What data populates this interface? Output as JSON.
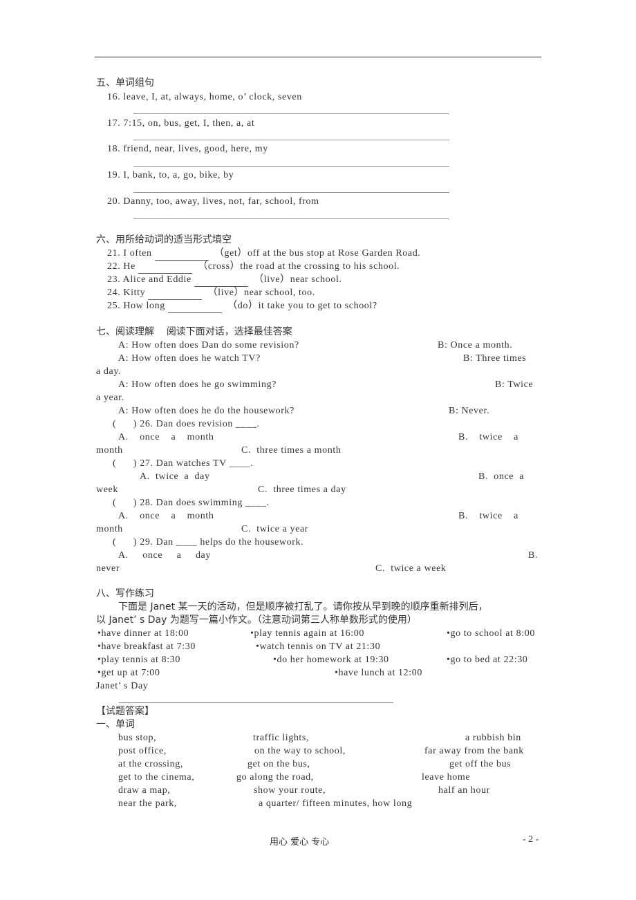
{
  "section5": {
    "title": "五、单词组句",
    "items": [
      {
        "num": "16.",
        "text": "leave, I, at, always, home, o’ clock, seven"
      },
      {
        "num": "17.",
        "text": "7:15, on, bus, get, I, then, a, at"
      },
      {
        "num": "18.",
        "text": "friend, near, lives, good, here, my"
      },
      {
        "num": "19.",
        "text": "I, bank, to, a, go, bike, by"
      },
      {
        "num": "20.",
        "text": "Danny, too, away, lives, not, far, school, from"
      }
    ]
  },
  "section6": {
    "title": "六、用所给动词的适当形式填空",
    "items": [
      {
        "num": "21.",
        "before": "I often",
        "verb": "（get）",
        "after": "off at the bus stop at Rose Garden Road."
      },
      {
        "num": "22.",
        "before": "He",
        "verb": "（cross）",
        "after": "the road at the crossing to his school."
      },
      {
        "num": "23.",
        "before": "Alice and Eddie",
        "verb": "（live）",
        "after": "near school."
      },
      {
        "num": "24.",
        "before": "Kitty",
        "verb": "（live）",
        "after": "near school, too."
      },
      {
        "num": "25.",
        "before": "How long",
        "verb": "（do）",
        "after": "it take you to get to school?"
      }
    ]
  },
  "section7": {
    "title": "七、阅读理解",
    "subtitle": "阅读下面对话，选择最佳答案",
    "dialogue": [
      {
        "a": "A: How often does Dan do some revision?",
        "b": "B: Once a month.",
        "b_wrap": ""
      },
      {
        "a": "A: How often does he watch TV?",
        "b": "B: Three times",
        "b_wrap": "a day."
      },
      {
        "a": "A: How often does he go swimming?",
        "b": "B: Twice",
        "b_wrap": "a year."
      },
      {
        "a": "A: How often does he do the housework?",
        "b": "B: Never.",
        "b_wrap": ""
      }
    ],
    "questions": [
      {
        "paren": "(      )",
        "stem": "26. Dan does revision ____.",
        "a": "A.    once    a    month",
        "b": "B.    twice    a",
        "wrap": "month",
        "c": "C.  three times a month"
      },
      {
        "paren": "(      )",
        "stem": "27. Dan watches TV ____.",
        "a": "A.  twice  a  day",
        "b": "B.  once  a",
        "wrap": "week",
        "c": "C.  three times a day"
      },
      {
        "paren": "(      )",
        "stem": "28. Dan does swimming ____.",
        "a": "A.    once    a    month",
        "b": "B.    twice    a",
        "wrap": "month",
        "c": "C.  twice a year"
      },
      {
        "paren": "(      )",
        "stem": "29. Dan ____ helps do the housework.",
        "a": "A.     once     a     day",
        "b": "B.",
        "wrap": "never",
        "c": "C.  twice a week"
      }
    ]
  },
  "section8": {
    "title": "八、写作练习",
    "instruction_1": "下面是 Janet 某一天的活动，但是顺序被打乱了。请你按从早到晚的顺序重新排列后，",
    "instruction_2": "以 Janet’ s Day 为题写一篇小作文。（注意动词第三人称单数形式的使用）",
    "activities": [
      [
        "•have dinner at 18:00",
        "•play tennis again at 16:00",
        "•go to school at 8:00"
      ],
      [
        "•have breakfast at 7:30",
        "•watch tennis on TV at 21:30",
        ""
      ],
      [
        "•play tennis at 8:30",
        "•do her homework at 19:30",
        "•go to bed at 22:30"
      ],
      [
        "•get up at 7:00",
        "•have lunch at 12:00",
        ""
      ]
    ],
    "essay_title": "Janet’ s Day"
  },
  "answers": {
    "title": "【试题答案】",
    "section1_title": "一、单词",
    "rows": [
      [
        "bus stop,",
        "traffic lights,",
        "a rubbish bin"
      ],
      [
        "post office,",
        "on the way to school,",
        "far away from the bank"
      ],
      [
        "at the crossing,",
        "get on the bus,",
        "get off the bus"
      ],
      [
        "get to the cinema,",
        "go along the road,",
        "leave home"
      ],
      [
        "draw a map,",
        "show your route,",
        "half an hour"
      ],
      [
        "near the park,",
        "a quarter/ fifteen minutes, how long",
        ""
      ]
    ]
  },
  "footer": {
    "motto": "用心   爱心   专心",
    "page_number": "- 2 -"
  }
}
